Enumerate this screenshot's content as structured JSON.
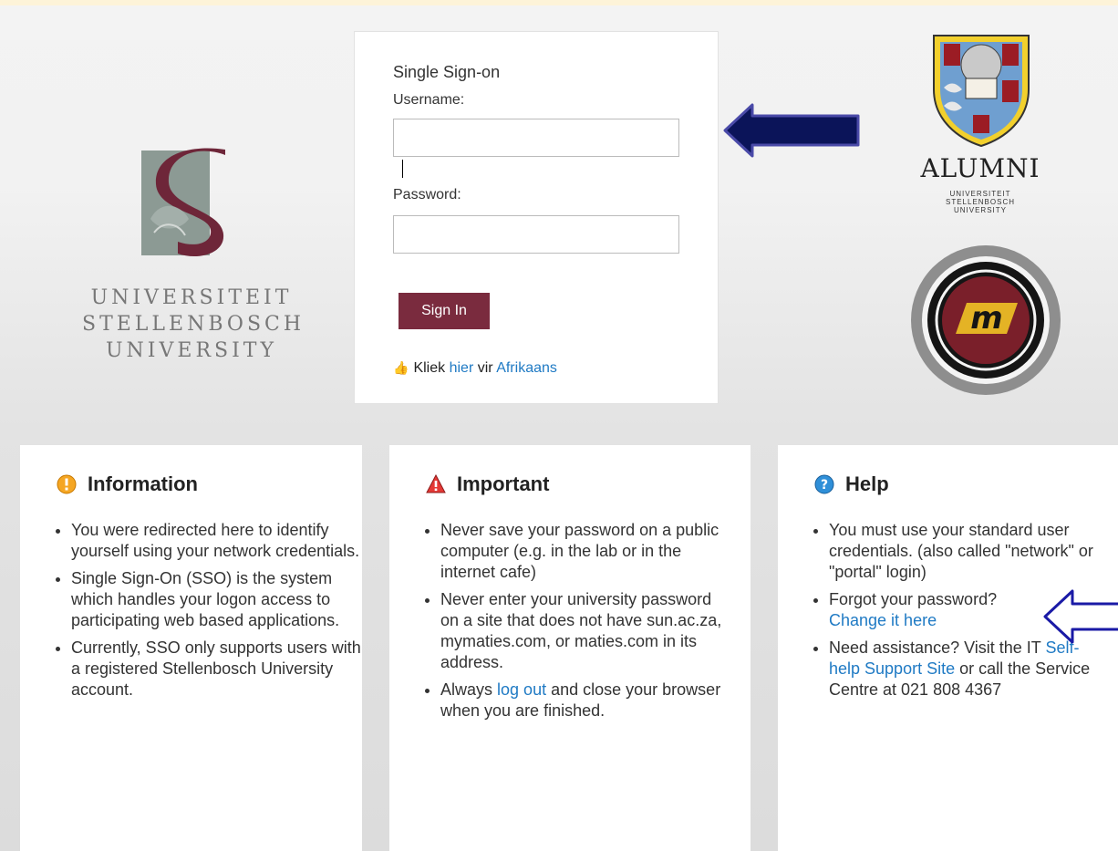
{
  "university": {
    "logo_lines": [
      "UNIVERSITEIT",
      "STELLENBOSCH",
      "UNIVERSITY"
    ]
  },
  "login": {
    "title": "Single Sign-on",
    "username_label": "Username:",
    "username_value": "",
    "password_label": "Password:",
    "password_value": "",
    "signin_label": "Sign In",
    "lang_prefix": "Kliek",
    "lang_link1": "hier",
    "lang_middle": "vir",
    "lang_link2": "Afrikaans"
  },
  "alumni": {
    "word": "ALUMNI",
    "sub_lines": [
      "UNIVERSITEIT",
      "STELLENBOSCH",
      "UNIVERSITY"
    ]
  },
  "cards": {
    "information": {
      "title": "Information",
      "items": [
        "You were redirected here to identify yourself using your network credentials.",
        "Single Sign-On (SSO) is the system which handles your logon access to participating web based applications.",
        "Currently, SSO only supports users with a registered Stellenbosch University account."
      ]
    },
    "important": {
      "title": "Important",
      "item1": "Never save your password on a public computer (e.g. in the lab or in the internet cafe)",
      "item2": "Never enter your university password on a site that does not have sun.ac.za, mymaties.com, or maties.com in its address.",
      "item3_prefix": "Always",
      "item3_link": "log out",
      "item3_suffix": "and close your browser when you are finished."
    },
    "help": {
      "title": "Help",
      "item1": "You must use your standard user credentials. (also called \"network\" or \"portal\" login)",
      "item2_text": "Forgot your password?",
      "item2_link": "Change it here",
      "item3_prefix": "Need assistance? Visit the IT",
      "item3_link": "Self-help Support Site",
      "item3_suffix": "or call the Service Centre at 021 808 4367"
    }
  },
  "colors": {
    "signin_bg": "#7a2b3e",
    "link": "#1f7ac4",
    "arrow": "#1a237e"
  },
  "icons": {
    "info": "info-circle-icon",
    "important": "warning-triangle-icon",
    "help": "question-circle-icon"
  }
}
